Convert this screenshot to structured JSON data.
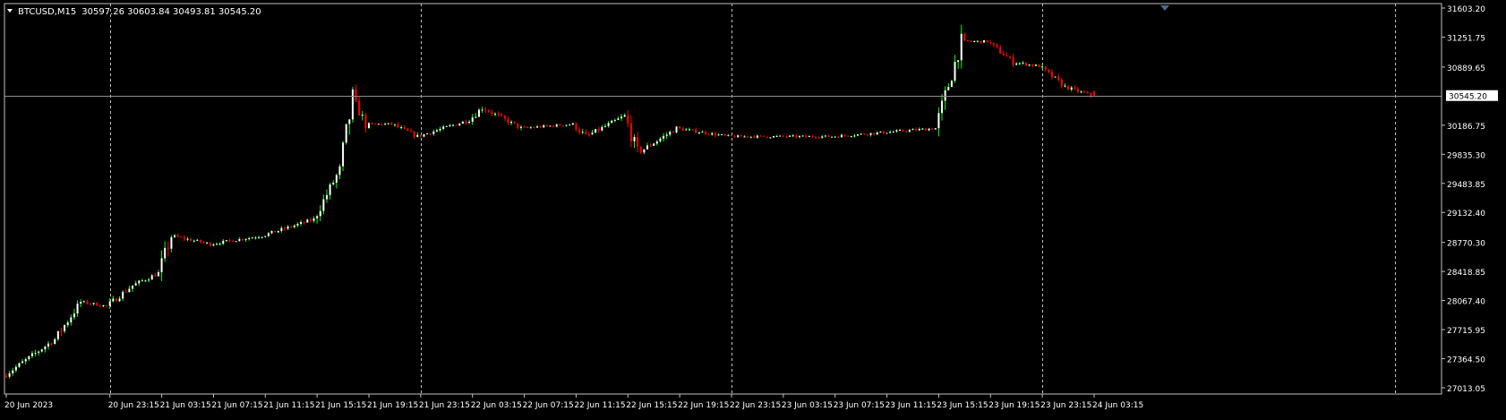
{
  "header": {
    "symbol": "BTCUSD,M15",
    "ohlc": "30597.26 30603.84 30493.81 30545.20"
  },
  "colors": {
    "background": "#000000",
    "frame": "#c0c0c0",
    "grid": "#c0c0c0",
    "axis_text": "#ffffff",
    "bull_candle": "#ffffff",
    "bull_wick": "#00ff00",
    "bear_candle": "#ff0000",
    "bid_line": "#8c8c8c",
    "price_label_bg": "#ffffff",
    "price_label_text": "#000000"
  },
  "chart_data": {
    "type": "candlestick",
    "symbol": "BTCUSD",
    "timeframe": "M15",
    "ohlc_last": {
      "open": 30597.26,
      "high": 30603.84,
      "low": 30493.81,
      "close": 30545.2
    },
    "current_price_label": "30545.20",
    "current_price": 30545.2,
    "ylim": [
      27013.05,
      31603.2
    ],
    "y_ticks": [
      "31603.20",
      "31251.75",
      "30889.65",
      "30545.20",
      "30186.75",
      "29835.30",
      "29483.85",
      "29132.40",
      "28770.30",
      "28418.85",
      "28067.40",
      "27715.95",
      "27364.50",
      "27013.05"
    ],
    "x_ticks": [
      "20 Jun 2023",
      "20 Jun 23:15",
      "21 Jun 03:15",
      "21 Jun 07:15",
      "21 Jun 11:15",
      "21 Jun 15:15",
      "21 Jun 19:15",
      "21 Jun 23:15",
      "22 Jun 03:15",
      "22 Jun 07:15",
      "22 Jun 11:15",
      "22 Jun 15:15",
      "22 Jun 19:15",
      "22 Jun 23:15",
      "23 Jun 03:15",
      "23 Jun 07:15",
      "23 Jun 11:15",
      "23 Jun 15:15",
      "23 Jun 19:15",
      "23 Jun 23:15",
      "24 Jun 03:15"
    ],
    "period_separators": [
      "20 Jun 23:15",
      "21 Jun 23:15",
      "22 Jun 23:15",
      "23 Jun 23:15"
    ],
    "price_path": [
      {
        "x": "20 Jun 2023",
        "y": 27150
      },
      {
        "x": "20 Jun 19:15",
        "y": 27600
      },
      {
        "x": "20 Jun 21:15",
        "y": 28050
      },
      {
        "x": "20 Jun 23:15",
        "y": 28000
      },
      {
        "x": "21 Jun 01:15",
        "y": 28250
      },
      {
        "x": "21 Jun 03:15",
        "y": 28400
      },
      {
        "x": "21 Jun 04:15",
        "y": 28850
      },
      {
        "x": "21 Jun 07:15",
        "y": 28750
      },
      {
        "x": "21 Jun 11:15",
        "y": 28850
      },
      {
        "x": "21 Jun 13:15",
        "y": 28950
      },
      {
        "x": "21 Jun 15:15",
        "y": 29050
      },
      {
        "x": "21 Jun 17:15",
        "y": 29650
      },
      {
        "x": "21 Jun 18:15",
        "y": 30500
      },
      {
        "x": "21 Jun 19:15",
        "y": 30200
      },
      {
        "x": "21 Jun 21:15",
        "y": 30200
      },
      {
        "x": "21 Jun 23:15",
        "y": 30050
      },
      {
        "x": "22 Jun 03:15",
        "y": 30250
      },
      {
        "x": "22 Jun 04:15",
        "y": 30400
      },
      {
        "x": "22 Jun 07:15",
        "y": 30150
      },
      {
        "x": "22 Jun 11:15",
        "y": 30200
      },
      {
        "x": "22 Jun 12:15",
        "y": 30050
      },
      {
        "x": "22 Jun 15:15",
        "y": 30300
      },
      {
        "x": "22 Jun 16:15",
        "y": 29850
      },
      {
        "x": "22 Jun 19:15",
        "y": 30150
      },
      {
        "x": "22 Jun 23:15",
        "y": 30050
      },
      {
        "x": "23 Jun 03:15",
        "y": 30050
      },
      {
        "x": "23 Jun 07:15",
        "y": 30050
      },
      {
        "x": "23 Jun 11:15",
        "y": 30100
      },
      {
        "x": "23 Jun 15:15",
        "y": 30150
      },
      {
        "x": "23 Jun 17:15",
        "y": 31200
      },
      {
        "x": "23 Jun 19:15",
        "y": 31200
      },
      {
        "x": "23 Jun 21:15",
        "y": 30950
      },
      {
        "x": "23 Jun 23:15",
        "y": 30900
      },
      {
        "x": "24 Jun 01:15",
        "y": 30650
      },
      {
        "x": "24 Jun 03:15",
        "y": 30545.2
      }
    ]
  }
}
